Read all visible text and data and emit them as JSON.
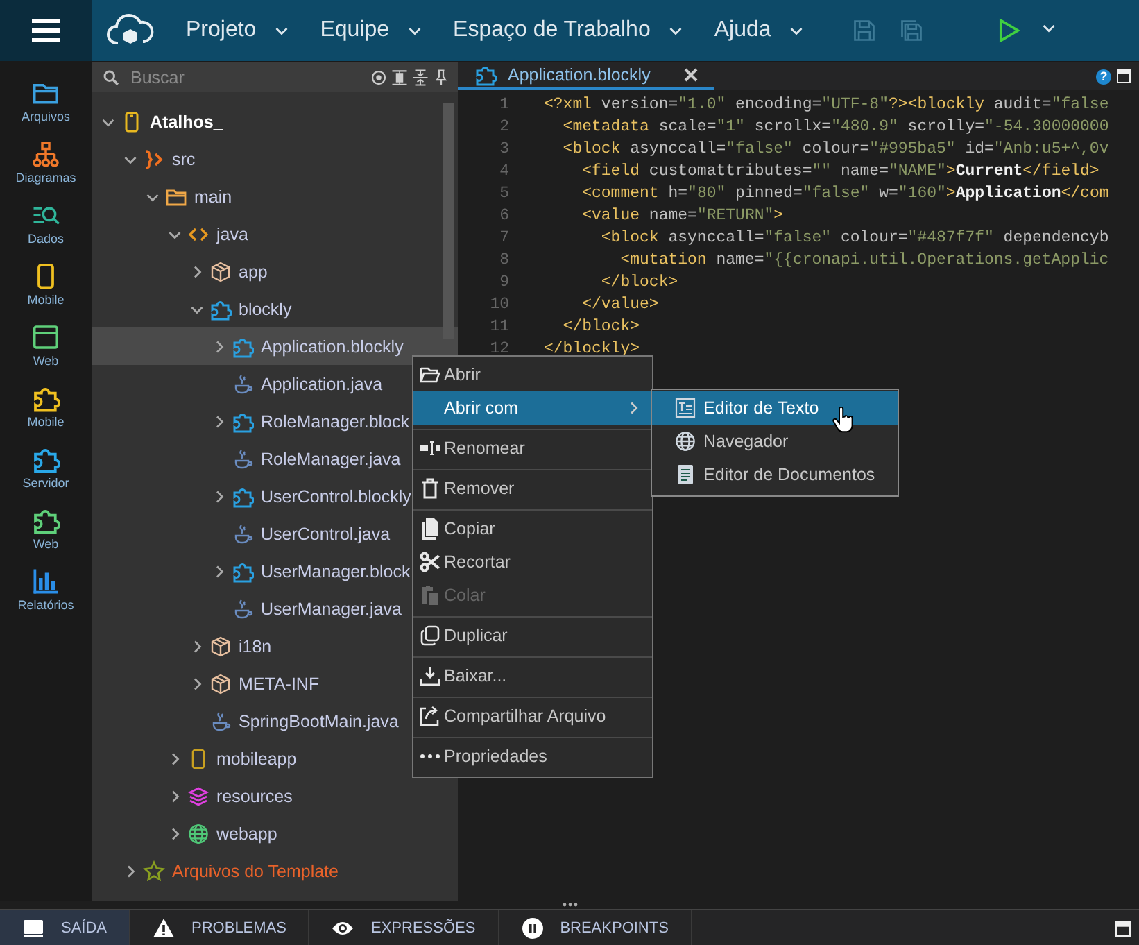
{
  "menubar": {
    "items": [
      {
        "label": "Projeto"
      },
      {
        "label": "Equipe"
      },
      {
        "label": "Espaço de Trabalho"
      },
      {
        "label": "Ajuda"
      }
    ],
    "save_disabled": true
  },
  "activity_bar": [
    {
      "label": "Arquivos",
      "kind": "folder",
      "color": "#3aa0e0"
    },
    {
      "label": "Diagramas",
      "kind": "orgchart",
      "color": "#f0782a"
    },
    {
      "label": "Dados",
      "kind": "data",
      "color": "#2fb59a"
    },
    {
      "label": "Mobile",
      "kind": "phone",
      "color": "#f0c020"
    },
    {
      "label": "Web",
      "kind": "window",
      "color": "#5fd07a"
    },
    {
      "label": "Mobile",
      "kind": "puzzle",
      "color": "#f0c020"
    },
    {
      "label": "Servidor",
      "kind": "puzzle",
      "color": "#2aa8e8"
    },
    {
      "label": "Web",
      "kind": "puzzle",
      "color": "#5fd07a"
    },
    {
      "label": "Relatórios",
      "kind": "barchart",
      "color": "#2a8ee8"
    }
  ],
  "search": {
    "placeholder": "Buscar"
  },
  "tree": [
    {
      "label": "Atalhos_",
      "kind": "project",
      "expanded": true,
      "selected": false,
      "children": [
        {
          "label": "src",
          "kind": "src",
          "expanded": true,
          "selected": false,
          "children": [
            {
              "label": "main",
              "kind": "folder",
              "expanded": true,
              "selected": false,
              "children": [
                {
                  "label": "java",
                  "kind": "source",
                  "expanded": true,
                  "selected": false,
                  "children": [
                    {
                      "label": "app",
                      "kind": "package",
                      "expanded": false,
                      "selected": false
                    },
                    {
                      "label": "blockly",
                      "kind": "blockly",
                      "expanded": true,
                      "selected": false,
                      "children": [
                        {
                          "label": "Application.blockly",
                          "kind": "blockly",
                          "expanded": false,
                          "selected": true
                        },
                        {
                          "label": "Application.java",
                          "kind": "java",
                          "selected": false
                        },
                        {
                          "label": "RoleManager.block",
                          "kind": "blockly",
                          "expanded": false,
                          "selected": false
                        },
                        {
                          "label": "RoleManager.java",
                          "kind": "java",
                          "selected": false
                        },
                        {
                          "label": "UserControl.blockly",
                          "kind": "blockly",
                          "expanded": false,
                          "selected": false
                        },
                        {
                          "label": "UserControl.java",
                          "kind": "java",
                          "selected": false
                        },
                        {
                          "label": "UserManager.block",
                          "kind": "blockly",
                          "expanded": false,
                          "selected": false
                        },
                        {
                          "label": "UserManager.java",
                          "kind": "java",
                          "selected": false
                        }
                      ]
                    },
                    {
                      "label": "i18n",
                      "kind": "package",
                      "expanded": false,
                      "selected": false
                    },
                    {
                      "label": "META-INF",
                      "kind": "package",
                      "expanded": false,
                      "selected": false
                    },
                    {
                      "label": "SpringBootMain.java",
                      "kind": "java",
                      "selected": false
                    }
                  ]
                },
                {
                  "label": "mobileapp",
                  "kind": "mobile",
                  "expanded": false,
                  "selected": false
                },
                {
                  "label": "resources",
                  "kind": "resources",
                  "expanded": false,
                  "selected": false
                },
                {
                  "label": "webapp",
                  "kind": "web",
                  "expanded": false,
                  "selected": false
                }
              ]
            }
          ]
        },
        {
          "label": "Arquivos do Template",
          "kind": "template",
          "expanded": false,
          "selected": false
        }
      ]
    }
  ],
  "editor": {
    "tab": {
      "label": "Application.blockly",
      "selected": true
    },
    "help": "?",
    "lines": [
      {
        "number": "1",
        "segments": [
          {
            "kind": "tag",
            "text": "<?xml"
          },
          {
            "kind": "attr",
            "text": " version="
          },
          {
            "kind": "str",
            "text": "\"1.0\""
          },
          {
            "kind": "attr",
            "text": " encoding="
          },
          {
            "kind": "str",
            "text": "\"UTF-8\""
          },
          {
            "kind": "tag",
            "text": "?><blockly"
          },
          {
            "kind": "attr",
            "text": " audit="
          },
          {
            "kind": "str",
            "text": "\"false"
          }
        ]
      },
      {
        "number": "2",
        "segments": [
          {
            "kind": "tag",
            "text": "  <metadata"
          },
          {
            "kind": "attr",
            "text": " scale="
          },
          {
            "kind": "str",
            "text": "\"1\""
          },
          {
            "kind": "attr",
            "text": " scrollx="
          },
          {
            "kind": "str",
            "text": "\"480.9\""
          },
          {
            "kind": "attr",
            "text": " scrolly="
          },
          {
            "kind": "str",
            "text": "\"-54.30000000"
          }
        ]
      },
      {
        "number": "3",
        "segments": [
          {
            "kind": "tag",
            "text": "  <block"
          },
          {
            "kind": "attr",
            "text": " asynccall="
          },
          {
            "kind": "str",
            "text": "\"false\""
          },
          {
            "kind": "attr",
            "text": " colour="
          },
          {
            "kind": "str",
            "text": "\"#995ba5\""
          },
          {
            "kind": "attr",
            "text": " id="
          },
          {
            "kind": "str",
            "text": "\"Anb:u5+^,0v"
          }
        ]
      },
      {
        "number": "4",
        "segments": [
          {
            "kind": "tag",
            "text": "    <field"
          },
          {
            "kind": "attr",
            "text": " customattributes="
          },
          {
            "kind": "str",
            "text": "\"\""
          },
          {
            "kind": "attr",
            "text": " name="
          },
          {
            "kind": "str",
            "text": "\"NAME\""
          },
          {
            "kind": "tag",
            "text": ">"
          },
          {
            "kind": "text",
            "text": "Current"
          },
          {
            "kind": "tag",
            "text": "</field>"
          }
        ]
      },
      {
        "number": "5",
        "segments": [
          {
            "kind": "tag",
            "text": "    <comment"
          },
          {
            "kind": "attr",
            "text": " h="
          },
          {
            "kind": "str",
            "text": "\"80\""
          },
          {
            "kind": "attr",
            "text": " pinned="
          },
          {
            "kind": "str",
            "text": "\"false\""
          },
          {
            "kind": "attr",
            "text": " w="
          },
          {
            "kind": "str",
            "text": "\"160\""
          },
          {
            "kind": "tag",
            "text": ">"
          },
          {
            "kind": "text",
            "text": "Application"
          },
          {
            "kind": "tag",
            "text": "</com"
          }
        ]
      },
      {
        "number": "6",
        "segments": [
          {
            "kind": "tag",
            "text": "    <value"
          },
          {
            "kind": "attr",
            "text": " name="
          },
          {
            "kind": "str",
            "text": "\"RETURN\""
          },
          {
            "kind": "tag",
            "text": ">"
          }
        ]
      },
      {
        "number": "7",
        "segments": [
          {
            "kind": "tag",
            "text": "      <block"
          },
          {
            "kind": "attr",
            "text": " asynccall="
          },
          {
            "kind": "str",
            "text": "\"false\""
          },
          {
            "kind": "attr",
            "text": " colour="
          },
          {
            "kind": "str",
            "text": "\"#487f7f\""
          },
          {
            "kind": "attr",
            "text": " dependencyb"
          }
        ]
      },
      {
        "number": "8",
        "segments": [
          {
            "kind": "tag",
            "text": "        <mutation"
          },
          {
            "kind": "attr",
            "text": " name="
          },
          {
            "kind": "str",
            "text": "\"{{cronapi.util.Operations.getApplic"
          }
        ]
      },
      {
        "number": "9",
        "segments": [
          {
            "kind": "tag",
            "text": "      </block>"
          }
        ]
      },
      {
        "number": "10",
        "segments": [
          {
            "kind": "tag",
            "text": "    </value>"
          }
        ]
      },
      {
        "number": "11",
        "segments": [
          {
            "kind": "tag",
            "text": "  </block>"
          }
        ]
      },
      {
        "number": "12",
        "segments": [
          {
            "kind": "tag",
            "text": "</blockly>"
          }
        ]
      }
    ]
  },
  "context_menu": {
    "groups": [
      {
        "items": [
          {
            "label": "Abrir",
            "kind": "open",
            "selected": false,
            "disabled": false
          },
          {
            "label": "Abrir com",
            "kind": "none",
            "selected": true,
            "disabled": false,
            "submenu": [
              {
                "label": "Editor de Texto",
                "kind": "text-editor",
                "selected": true
              },
              {
                "label": "Navegador",
                "kind": "globe",
                "selected": false
              },
              {
                "label": "Editor de Documentos",
                "kind": "document",
                "selected": false
              }
            ]
          }
        ]
      },
      {
        "items": [
          {
            "label": "Renomear",
            "kind": "rename",
            "selected": false,
            "disabled": false
          }
        ]
      },
      {
        "items": [
          {
            "label": "Remover",
            "kind": "trash",
            "selected": false,
            "disabled": false
          }
        ]
      },
      {
        "items": [
          {
            "label": "Copiar",
            "kind": "copy",
            "selected": false,
            "disabled": false
          },
          {
            "label": "Recortar",
            "kind": "scissors",
            "selected": false,
            "disabled": false
          },
          {
            "label": "Colar",
            "kind": "paste",
            "selected": false,
            "disabled": true
          }
        ]
      },
      {
        "items": [
          {
            "label": "Duplicar",
            "kind": "duplicate",
            "selected": false,
            "disabled": false
          }
        ]
      },
      {
        "items": [
          {
            "label": "Baixar...",
            "kind": "download",
            "selected": false,
            "disabled": false
          }
        ]
      },
      {
        "items": [
          {
            "label": "Compartilhar Arquivo",
            "kind": "share",
            "selected": false,
            "disabled": false
          }
        ]
      },
      {
        "items": [
          {
            "label": "Propriedades",
            "kind": "dots",
            "selected": false,
            "disabled": false
          }
        ]
      }
    ]
  },
  "bottom_tabs": [
    {
      "label": "SAÍDA",
      "kind": "output",
      "selected": true
    },
    {
      "label": "PROBLEMAS",
      "kind": "warning",
      "selected": false
    },
    {
      "label": "EXPRESSÕES",
      "kind": "eye",
      "selected": false
    },
    {
      "label": "BREAKPOINTS",
      "kind": "pause",
      "selected": false
    }
  ]
}
